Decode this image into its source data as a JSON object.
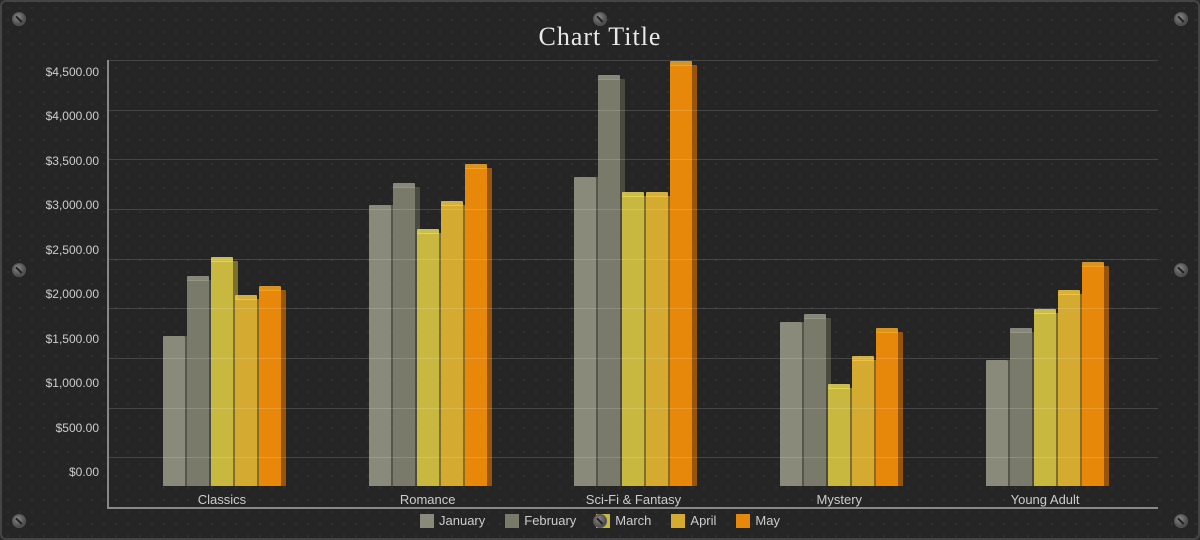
{
  "title": "Chart Title",
  "yAxis": {
    "labels": [
      "$4,500.00",
      "$4,000.00",
      "$3,500.00",
      "$3,000.00",
      "$2,500.00",
      "$2,000.00",
      "$1,500.00",
      "$1,000.00",
      "$500.00",
      "$0.00"
    ]
  },
  "categories": [
    {
      "name": "Classics",
      "values": {
        "jan": 1600,
        "feb": 2200,
        "mar": 2400,
        "apr": 2000,
        "may": 2100
      }
    },
    {
      "name": "Romance",
      "values": {
        "jan": 3000,
        "feb": 3200,
        "mar": 2700,
        "apr": 3000,
        "may": 3400
      }
    },
    {
      "name": "Sci-Fi & Fantasy",
      "values": {
        "jan": 3300,
        "feb": 4350,
        "mar": 3100,
        "apr": 3100,
        "may": 4500
      }
    },
    {
      "name": "Mystery",
      "values": {
        "jan": 1750,
        "feb": 1800,
        "mar": 1050,
        "apr": 1350,
        "may": 1650
      }
    },
    {
      "name": "Young Adult",
      "values": {
        "jan": 1350,
        "feb": 1650,
        "mar": 1850,
        "apr": 2050,
        "may": 2350
      }
    }
  ],
  "legend": [
    {
      "key": "jan",
      "label": "January",
      "color": "#8a8a7a"
    },
    {
      "key": "feb",
      "label": "February",
      "color": "#7a7a6a"
    },
    {
      "key": "mar",
      "label": "March",
      "color": "#c8b840"
    },
    {
      "key": "apr",
      "label": "April",
      "color": "#d4aa30"
    },
    {
      "key": "may",
      "label": "May",
      "color": "#e8880a"
    }
  ],
  "maxValue": 4500
}
